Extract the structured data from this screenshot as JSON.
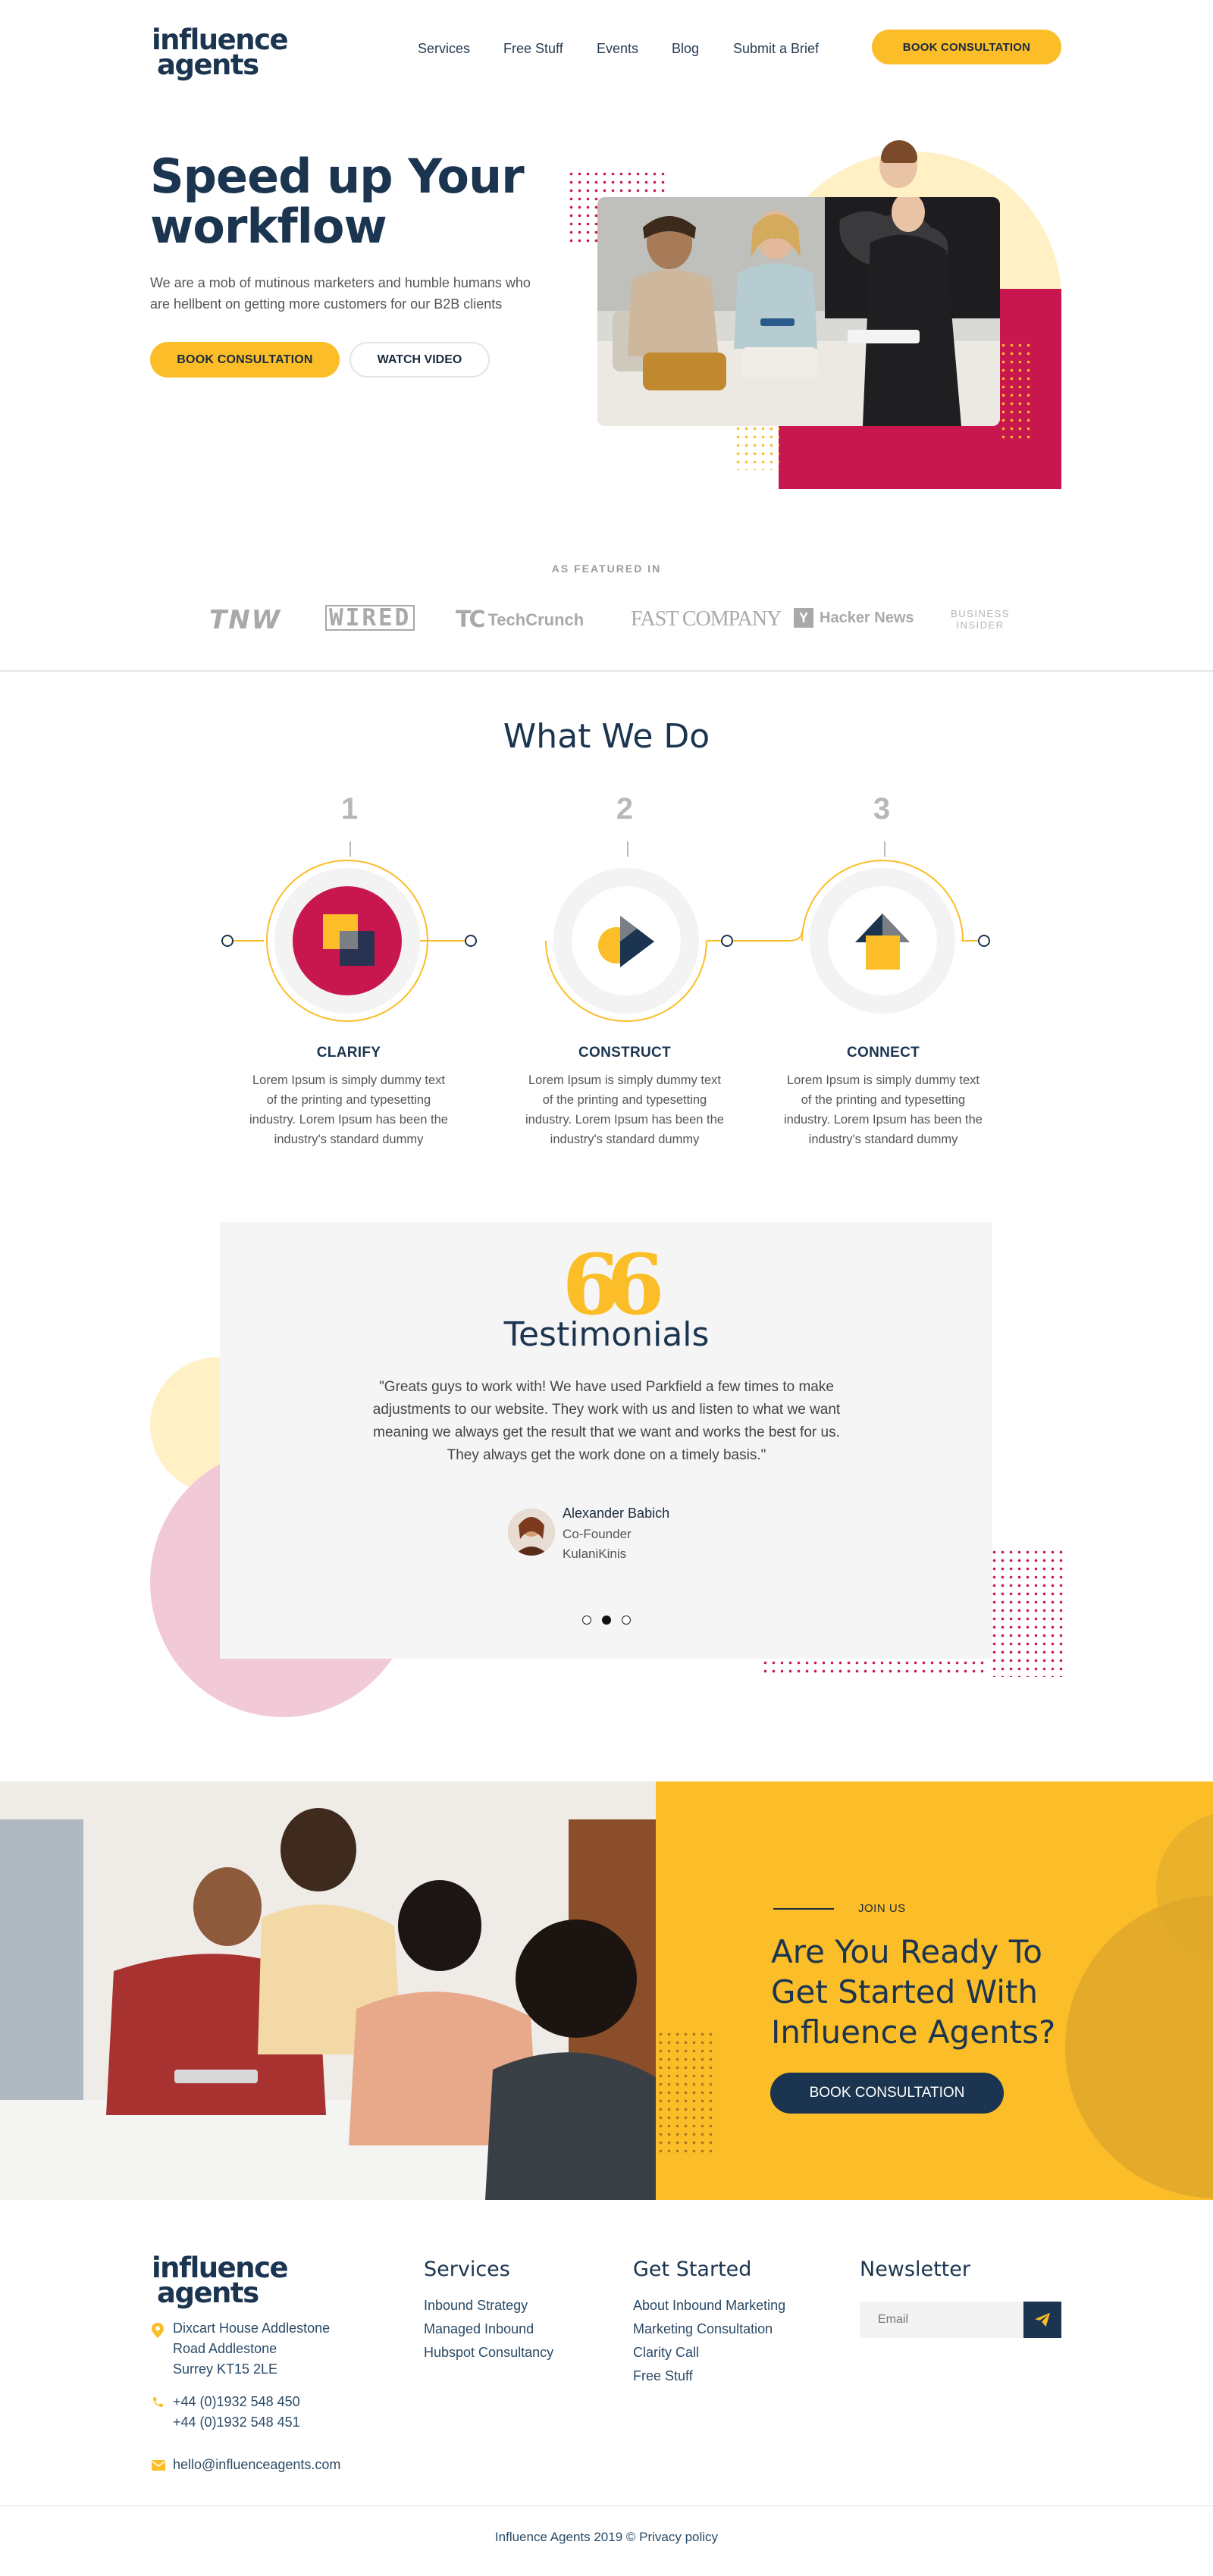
{
  "brand": {
    "logo_line1": "influence",
    "logo_line2": "agents"
  },
  "nav": {
    "items": [
      "Services",
      "Free Stuff",
      "Events",
      "Blog",
      "Submit a Brief"
    ],
    "cta": "BOOK CONSULTATION"
  },
  "hero": {
    "title_line1": "Speed up Your",
    "title_line2": "workflow",
    "subtitle_line1": "We are a mob of mutinous marketers and humble humans who",
    "subtitle_line2": "are hellbent on getting more customers for our B2B clients",
    "primary_button": "BOOK CONSULTATION",
    "secondary_button": "WATCH VIDEO"
  },
  "featured": {
    "label": "AS FEATURED IN",
    "logos": [
      "TNW",
      "WIRED",
      "TechCrunch",
      "FAST COMPANY",
      "Hacker News",
      "BUSINESS INSIDER"
    ],
    "logo_tc_mark": "TC",
    "logo_hn_mark": "Y"
  },
  "what_we_do": {
    "title": "What We Do",
    "steps": [
      {
        "number": "1",
        "title": "CLARIFY",
        "desc": "Lorem Ipsum is simply dummy text of the printing and typesetting industry. Lorem Ipsum has been the industry's standard dummy"
      },
      {
        "number": "2",
        "title": "CONSTRUCT",
        "desc": "Lorem Ipsum is simply dummy text of the printing and typesetting industry. Lorem Ipsum has been the industry's standard dummy"
      },
      {
        "number": "3",
        "title": "CONNECT",
        "desc": "Lorem Ipsum is simply dummy text of the printing and typesetting industry. Lorem Ipsum has been the industry's standard dummy"
      }
    ]
  },
  "testimonials": {
    "title": "Testimonials",
    "quote_mark": "66",
    "quote_line1": "\"Greats guys to work with! We have used Parkfield a few times to make",
    "quote_line2": "adjustments to our website. They work with us and listen to what we want",
    "quote_line3": "meaning we always get the result that we want and works the best for us.",
    "quote_line4": "They always get the work done on a timely basis.\"",
    "author_name": "Alexander Babich",
    "author_role": "Co-Founder",
    "author_company": "KulaniKinis",
    "active_dot": 2
  },
  "cta_section": {
    "eyebrow": "JOIN US",
    "title_line1": "Are You Ready To",
    "title_line2": "Get Started With",
    "title_line3": "Influence Agents?",
    "button": "BOOK CONSULTATION"
  },
  "footer": {
    "address_line1": "Dixcart House Addlestone",
    "address_line2": "Road Addlestone",
    "address_line3": "Surrey KT15 2LE",
    "phone1": "+44 (0)1932 548 450",
    "phone2": "+44 (0)1932 548 451",
    "email": "hello@influenceagents.com",
    "services_heading": "Services",
    "services": [
      "Inbound Strategy",
      "Managed Inbound",
      "Hubspot Consultancy"
    ],
    "get_started_heading": "Get Started",
    "get_started": [
      "About Inbound Marketing",
      "Marketing Consultation",
      "Clarity Call",
      "Free Stuff"
    ],
    "newsletter_heading": "Newsletter",
    "newsletter_placeholder": "Email",
    "copyright": "Influence Agents 2019 © Privacy policy"
  },
  "colors": {
    "navy": "#1b3550",
    "yellow": "#fbbd28",
    "crimson": "#c8174e",
    "light_yellow": "#fff0c6",
    "grey_bg": "#f5f5f5"
  },
  "icons": [
    "location-pin-icon",
    "phone-icon",
    "envelope-icon",
    "send-icon",
    "quote-icon"
  ]
}
